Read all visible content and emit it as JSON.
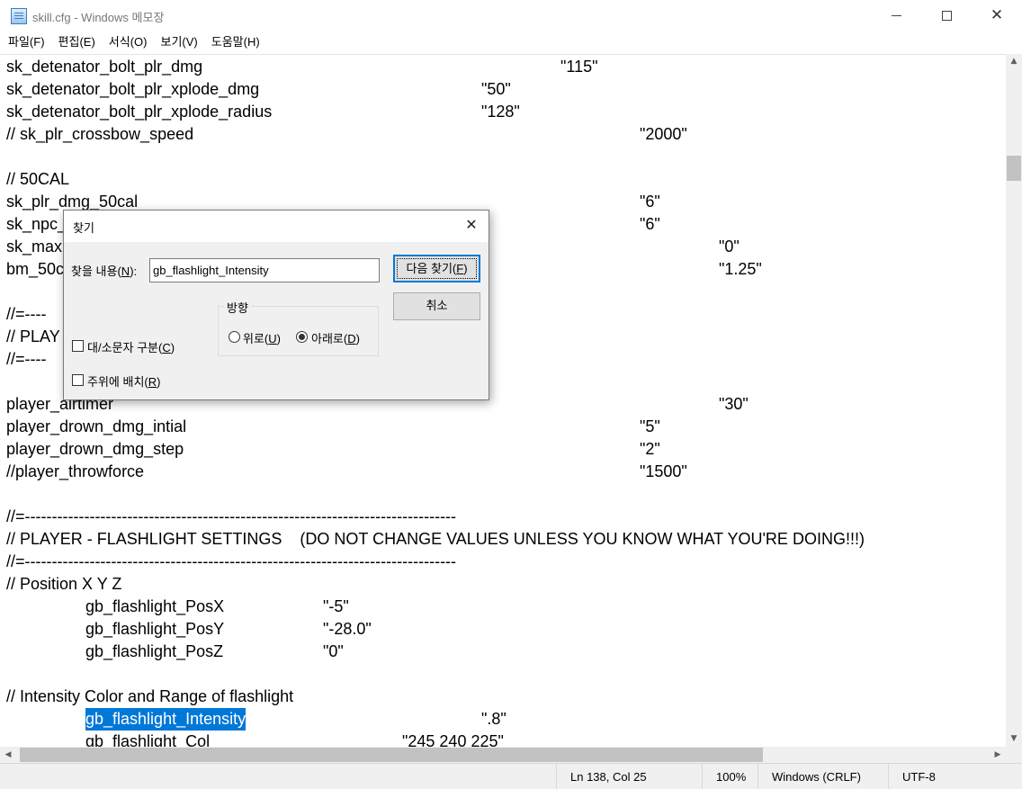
{
  "window": {
    "title": "skill.cfg - Windows 메모장",
    "minimize": "—",
    "maximize": "☐",
    "close": "✕"
  },
  "menu": [
    "파일(F)",
    "편집(E)",
    "서식(O)",
    "보기(V)",
    "도움말(H)"
  ],
  "editor_lines": [
    {
      "text": "sk_detenator_bolt_plr_dmg",
      "value": "\"115\""
    },
    {
      "text": "sk_detenator_bolt_plr_xplode_dmg",
      "value": "\"50\""
    },
    {
      "text": "sk_detenator_bolt_plr_xplode_radius",
      "value": "\"128\""
    },
    {
      "text": "// sk_plr_crossbow_speed",
      "value": "\"2000\""
    },
    {
      "text": "",
      "value": ""
    },
    {
      "text": "// 50CAL",
      "value": ""
    },
    {
      "text": "sk_plr_dmg_50cal",
      "value": "\"6\""
    },
    {
      "text": "sk_npc_",
      "value": "\"6\""
    },
    {
      "text": "sk_max",
      "value": "\"0\""
    },
    {
      "text": "bm_50c",
      "value": "\"1.25\""
    },
    {
      "text": "",
      "value": ""
    },
    {
      "text": "//=----",
      "value": ""
    },
    {
      "text": "// PLAY",
      "value": ""
    },
    {
      "text": "//=----",
      "value": ""
    },
    {
      "text": "",
      "value": ""
    },
    {
      "text": "player_airtimer",
      "value": "\"30\""
    },
    {
      "text": "player_drown_dmg_intial",
      "value": "\"5\""
    },
    {
      "text": "player_drown_dmg_step",
      "value": "\"2\""
    },
    {
      "text": "//player_throwforce",
      "value": "\"1500\""
    },
    {
      "text": "",
      "value": ""
    },
    {
      "text": "//=--------------------------------------------------------------------------------",
      "value": ""
    },
    {
      "text": "// PLAYER - FLASHLIGHT SETTINGS    (DO NOT CHANGE VALUES UNLESS YOU KNOW WHAT YOU'RE DOING!!!)",
      "value": ""
    },
    {
      "text": "//=--------------------------------------------------------------------------------",
      "value": ""
    },
    {
      "text": "// Position X Y Z",
      "value": ""
    },
    {
      "text": "gb_flashlight_PosX",
      "value": "\"-5\""
    },
    {
      "text": "gb_flashlight_PosY",
      "value": "\"-28.0\""
    },
    {
      "text": "gb_flashlight_PosZ",
      "value": "\"0\""
    },
    {
      "text": "",
      "value": ""
    },
    {
      "text": "// Intensity Color and Range of flashlight",
      "value": ""
    },
    {
      "text": "gb_flashlight_Intensity",
      "value": "\".8\""
    },
    {
      "text": "gb_flashlight_Col",
      "value": "\"245 240 225\""
    }
  ],
  "find_dialog": {
    "title": "찾기",
    "close": "✕",
    "find_what_label": "찾을 내용",
    "find_what_key": "N",
    "find_what_value": "gb_flashlight_Intensity",
    "find_next_label": "다음 찾기",
    "find_next_key": "F",
    "cancel_label": "취소",
    "direction_label": "방향",
    "up_label": "위로",
    "up_key": "U",
    "down_label": "아래로",
    "down_key": "D",
    "match_case_label": "대/소문자 구분",
    "match_case_key": "C",
    "wrap_label": "주위에 배치",
    "wrap_key": "R",
    "direction_selected": "down"
  },
  "status": {
    "position": "Ln 138, Col 25",
    "zoom": "100%",
    "line_ending": "Windows (CRLF)",
    "encoding": "UTF-8"
  },
  "colors": {
    "selection": "#0078d7",
    "default_button_border": "#0078d7"
  }
}
